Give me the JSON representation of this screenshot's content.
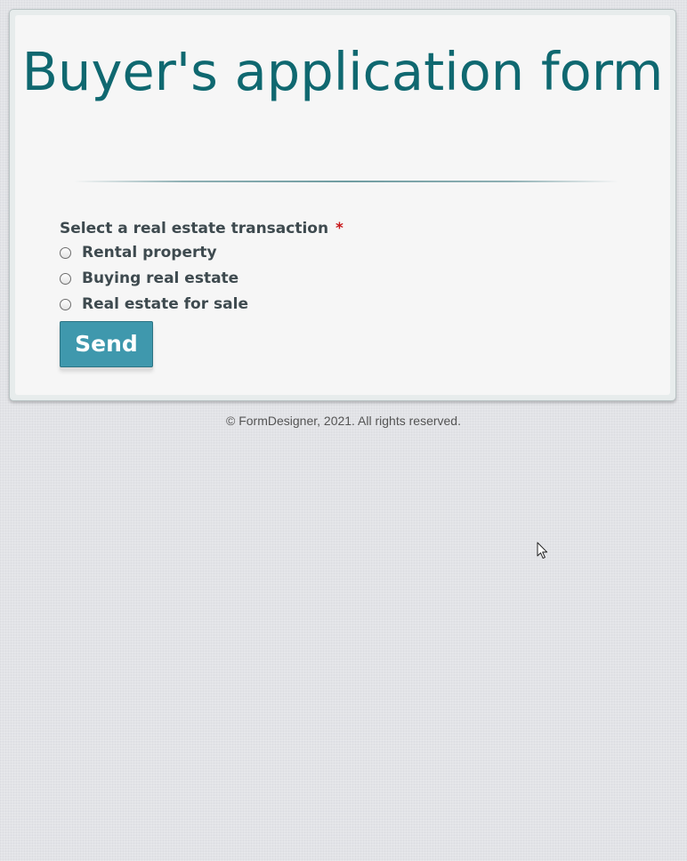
{
  "form": {
    "title": "Buyer's application form",
    "field": {
      "label": "Select a real estate transaction",
      "required_marker": "*",
      "options": [
        {
          "label": "Rental property",
          "checked": false
        },
        {
          "label": "Buying real estate",
          "checked": false
        },
        {
          "label": "Real estate for sale",
          "checked": false
        }
      ]
    },
    "submit_label": "Send"
  },
  "footer": {
    "copyright": "© FormDesigner, 2021. All rights reserved."
  },
  "icons": {
    "pointer": "mouse-cursor-icon"
  },
  "colors": {
    "title": "#0f6870",
    "button_bg": "#3f98ad",
    "required": "#c8171a",
    "label_text": "#3e4a4f"
  }
}
